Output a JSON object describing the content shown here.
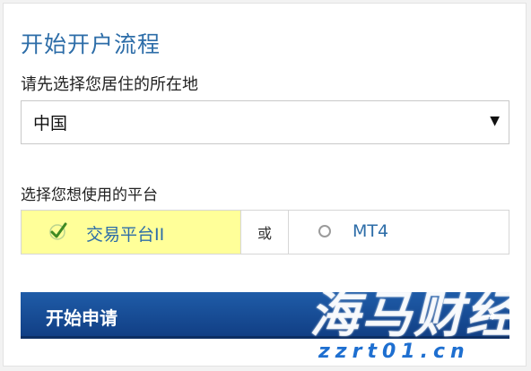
{
  "title": "开始开户流程",
  "residence": {
    "label": "请先选择您居住的所在地",
    "selected": "中国"
  },
  "platform": {
    "label": "选择您想使用的平台",
    "option1": "交易平台II",
    "or": "或",
    "option2": "MT4"
  },
  "start_button": "开始申请",
  "watermark": {
    "logo": "海马财经",
    "url": "zzrt01.cn"
  },
  "colors": {
    "accent": "#2d6da8",
    "button": "#1a4f99",
    "highlight": "#ffff99",
    "watermark_url": "#1e6fd0"
  }
}
